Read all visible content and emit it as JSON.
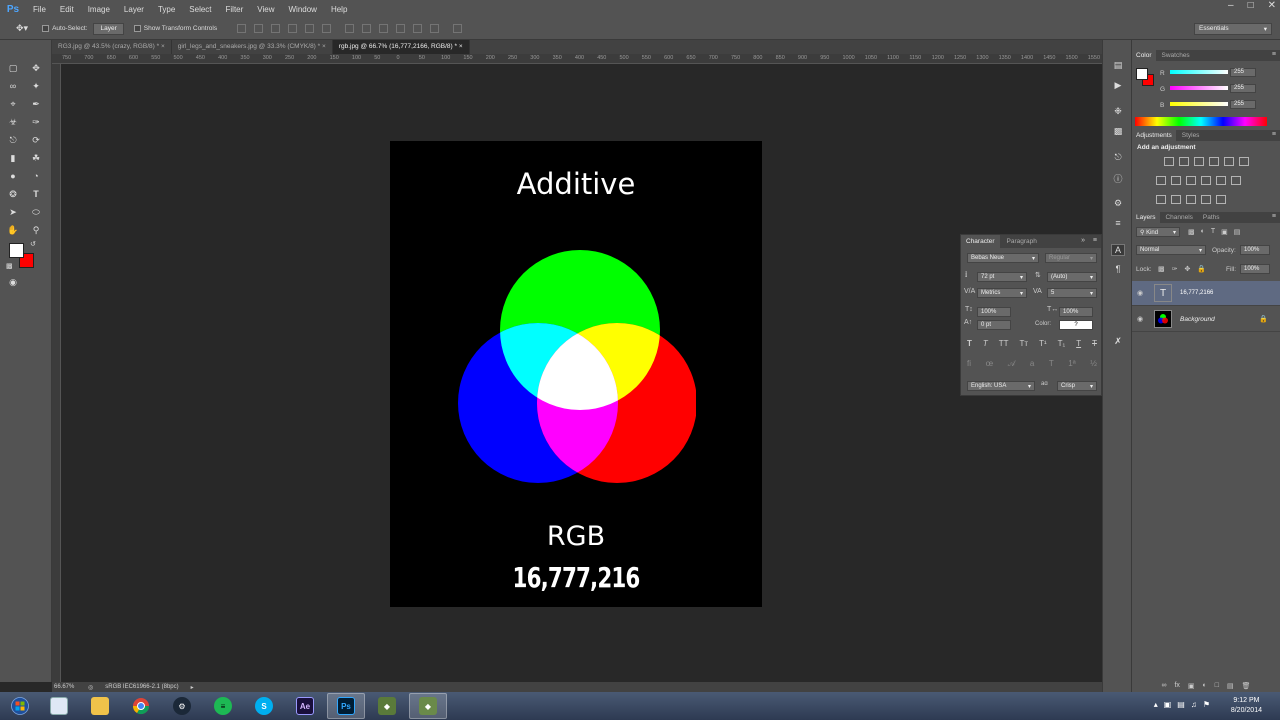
{
  "app": {
    "logo": "Ps"
  },
  "menu": [
    "File",
    "Edit",
    "Image",
    "Layer",
    "Type",
    "Select",
    "Filter",
    "View",
    "Window",
    "Help"
  ],
  "options_bar": {
    "auto_select_label": "Auto-Select:",
    "auto_select_value": "Layer",
    "show_transform_label": "Show Transform Controls",
    "workspace": "Essentials"
  },
  "doc_tabs": [
    {
      "label": "RG3.jpg @ 43.5% (crazy, RGB/8) *"
    },
    {
      "label": "girl_legs_and_sneakers.jpg @ 33.3% (CMYK/8) *"
    },
    {
      "label": "rgb.jpg @ 66.7% (16,777,2166, RGB/8) *"
    }
  ],
  "ruler_ticks": [
    "750",
    "700",
    "650",
    "600",
    "550",
    "500",
    "450",
    "400",
    "350",
    "300",
    "250",
    "200",
    "150",
    "100",
    "50",
    "0",
    "50",
    "100",
    "150",
    "200",
    "250",
    "300",
    "350",
    "400",
    "450",
    "500",
    "550",
    "600",
    "650",
    "700",
    "750",
    "800",
    "850",
    "900",
    "950",
    "1000",
    "1050",
    "1100",
    "1150",
    "1200",
    "1250",
    "1300",
    "1350",
    "1400",
    "1450",
    "1500",
    "1550"
  ],
  "document": {
    "title": "Additive",
    "subtitle": "RGB",
    "count": "16,777,216",
    "circle_colors": {
      "green": "#00ff00",
      "blue": "#0000ff",
      "red": "#ff0000",
      "cyan": "#00ffff",
      "yellow": "#ffff00",
      "magenta": "#ff00ff",
      "white": "#ffffff"
    }
  },
  "status_bar": {
    "zoom": "66.67%",
    "profile": "sRGB IEC61966-2.1 (8bpc)"
  },
  "character_panel": {
    "tabs": [
      "Character",
      "Paragraph"
    ],
    "font_family": "Bebas Neue",
    "font_style": "Regular",
    "font_size": "72 pt",
    "leading": "(Auto)",
    "kerning": "Metrics",
    "tracking": "5",
    "vertical_scale": "100%",
    "horizontal_scale": "100%",
    "baseline_shift": "0 pt",
    "color_label": "Color:",
    "color_value": "?",
    "language": "English: USA",
    "antialias": "Crisp",
    "aa_label": "aɑ"
  },
  "color_panel": {
    "tabs": [
      "Color",
      "Swatches"
    ],
    "channels": [
      {
        "label": "R",
        "value": "255"
      },
      {
        "label": "G",
        "value": "255"
      },
      {
        "label": "B",
        "value": "255"
      }
    ]
  },
  "adjustments_panel": {
    "tabs": [
      "Adjustments",
      "Styles"
    ],
    "heading": "Add an adjustment"
  },
  "layers_panel": {
    "tabs": [
      "Layers",
      "Channels",
      "Paths"
    ],
    "kind": "Kind",
    "blend_mode": "Normal",
    "opacity_label": "Opacity:",
    "opacity": "100%",
    "lock_label": "Lock:",
    "fill_label": "Fill:",
    "fill": "100%",
    "layers": [
      {
        "name": "16,777,2166",
        "type": "text"
      },
      {
        "name": "Background",
        "type": "image"
      }
    ]
  },
  "taskbar": {
    "apps": [
      "windows-explorer",
      "file-manager",
      "chrome",
      "steam",
      "spotify",
      "skype",
      "after-effects",
      "photoshop",
      "game-app",
      "game-app-2"
    ],
    "ae_label": "Ae",
    "ps_label": "Ps",
    "skype_label": "S",
    "time": "9:12 PM",
    "date": "8/20/2014"
  }
}
